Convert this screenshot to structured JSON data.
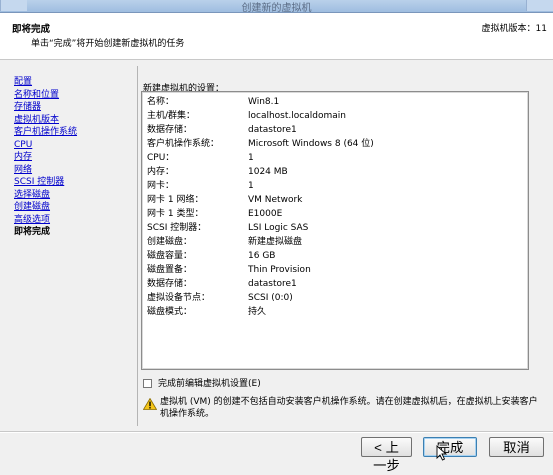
{
  "window": {
    "title": "创建新的虚拟机"
  },
  "header": {
    "title": "即将完成",
    "subtitle": "单击“完成”将开始创建新虚拟机的任务",
    "version_label": "虚拟机版本：11"
  },
  "nav": {
    "items": [
      {
        "label": "配置"
      },
      {
        "label": "名称和位置"
      },
      {
        "label": "存储器"
      },
      {
        "label": "虚拟机版本"
      },
      {
        "label": "客户机操作系统"
      },
      {
        "label": "CPU"
      },
      {
        "label": "内存"
      },
      {
        "label": "网络"
      },
      {
        "label": "SCSI 控制器"
      },
      {
        "label": "选择磁盘"
      },
      {
        "label": "创建磁盘"
      },
      {
        "label": "高级选项"
      },
      {
        "label": "即将完成"
      }
    ]
  },
  "settings": {
    "label": "新建虚拟机的设置：",
    "rows": [
      {
        "key": "名称：",
        "value": "Win8.1"
      },
      {
        "key": "主机/群集：",
        "value": "localhost.localdomain"
      },
      {
        "key": "数据存储：",
        "value": "datastore1"
      },
      {
        "key": "客户机操作系统：",
        "value": "Microsoft Windows 8 (64 位)"
      },
      {
        "key": "CPU：",
        "value": "1"
      },
      {
        "key": "内存：",
        "value": "1024 MB"
      },
      {
        "key": "网卡：",
        "value": "1"
      },
      {
        "key": "网卡 1 网络：",
        "value": "VM Network"
      },
      {
        "key": "网卡 1 类型：",
        "value": "E1000E"
      },
      {
        "key": "SCSI 控制器：",
        "value": "LSI Logic SAS"
      },
      {
        "key": "创建磁盘：",
        "value": "新建虚拟磁盘"
      },
      {
        "key": "磁盘容量：",
        "value": "16 GB"
      },
      {
        "key": "磁盘置备：",
        "value": "Thin Provision"
      },
      {
        "key": "数据存储：",
        "value": "datastore1"
      },
      {
        "key": "虚拟设备节点：",
        "value": "SCSI (0:0)"
      },
      {
        "key": "磁盘模式：",
        "value": "持久"
      }
    ]
  },
  "edit_before_finish": {
    "label": "完成前编辑虚拟机设置(E)",
    "checked": false
  },
  "warning": {
    "icon": "warning-icon",
    "text": "虚拟机 (VM) 的创建不包括自动安装客户机操作系统。请在创建虚拟机后，在虚拟机上安装客户机操作系统。"
  },
  "buttons": {
    "back": "< 上一步",
    "finish": "完成",
    "cancel": "取消"
  },
  "colors": {
    "link": "#0000cc",
    "titlebar": "#b9d1ea",
    "warning": "#f5c518"
  }
}
